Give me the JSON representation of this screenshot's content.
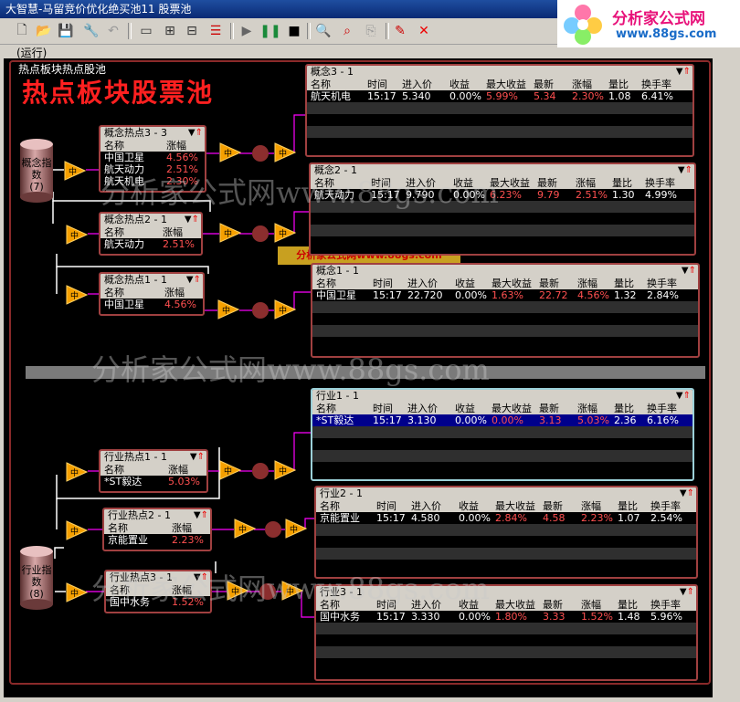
{
  "window_title": "大智慧-马留竞价优化绝买池11  股票池",
  "logo": {
    "line1": "分析家公式网",
    "line2": "www.88gs.com"
  },
  "status": "(运行)",
  "caption": "热点板块热点股池",
  "big_title": "热点板块股票池",
  "watermarks": {
    "main": "分析家公式网www.88gs.com",
    "ad": "分析家公式网www.88gs.com"
  },
  "sources": [
    {
      "name": "概念指数",
      "count": "(7)"
    },
    {
      "name": "行业指数",
      "count": "(8)"
    }
  ],
  "filters": [
    {
      "title": "概念热点3 - 3",
      "cols": [
        "名称",
        "涨幅"
      ],
      "rows": [
        [
          "中国卫星",
          "4.56%"
        ],
        [
          "航天动力",
          "2.51%"
        ],
        [
          "航天机电",
          "2.30%"
        ]
      ]
    },
    {
      "title": "概念热点2 - 1",
      "cols": [
        "名称",
        "涨幅"
      ],
      "rows": [
        [
          "航天动力",
          "2.51%"
        ]
      ]
    },
    {
      "title": "概念热点1 - 1",
      "cols": [
        "名称",
        "涨幅"
      ],
      "rows": [
        [
          "中国卫星",
          "4.56%"
        ]
      ]
    },
    {
      "title": "行业热点1 - 1",
      "cols": [
        "名称",
        "涨幅"
      ],
      "rows": [
        [
          "*ST毅达",
          "5.03%"
        ]
      ]
    },
    {
      "title": "行业热点2 - 1",
      "cols": [
        "名称",
        "涨幅"
      ],
      "rows": [
        [
          "京能置业",
          "2.23%"
        ]
      ]
    },
    {
      "title": "行业热点3 - 1",
      "cols": [
        "名称",
        "涨幅"
      ],
      "rows": [
        [
          "国中水务",
          "1.52%"
        ]
      ]
    }
  ],
  "result_cols": [
    "名称",
    "时间",
    "进入价",
    "收益",
    "最大收益",
    "最新",
    "涨幅",
    "量比",
    "换手率"
  ],
  "results": [
    {
      "title": "概念3 - 1",
      "row": [
        "航天机电",
        "15:17",
        "5.340",
        "0.00%",
        "5.99%",
        "5.34",
        "2.30%",
        "1.08",
        "6.41%"
      ]
    },
    {
      "title": "概念2 - 1",
      "row": [
        "航天动力",
        "15:17",
        "9.790",
        "0.00%",
        "6.23%",
        "9.79",
        "2.51%",
        "1.30",
        "4.99%"
      ]
    },
    {
      "title": "概念1 - 1",
      "row": [
        "中国卫星",
        "15:17",
        "22.720",
        "0.00%",
        "1.63%",
        "22.72",
        "4.56%",
        "1.32",
        "2.84%"
      ]
    },
    {
      "title": "行业1 - 1",
      "row": [
        "*ST毅达",
        "15:17",
        "3.130",
        "0.00%",
        "0.00%",
        "3.13",
        "5.03%",
        "2.36",
        "6.16%"
      ]
    },
    {
      "title": "行业2 - 1",
      "row": [
        "京能置业",
        "15:17",
        "4.580",
        "0.00%",
        "2.84%",
        "4.58",
        "2.23%",
        "1.07",
        "2.54%"
      ]
    },
    {
      "title": "行业3 - 1",
      "row": [
        "国中水务",
        "15:17",
        "3.330",
        "0.00%",
        "1.80%",
        "3.33",
        "1.52%",
        "1.48",
        "5.96%"
      ]
    }
  ],
  "node_label": "中",
  "colors": {
    "panel_border": "#a04040",
    "selected_border": "#9bd0d8",
    "up_text": "#ff5050",
    "flow_line": "#ff00ff"
  }
}
